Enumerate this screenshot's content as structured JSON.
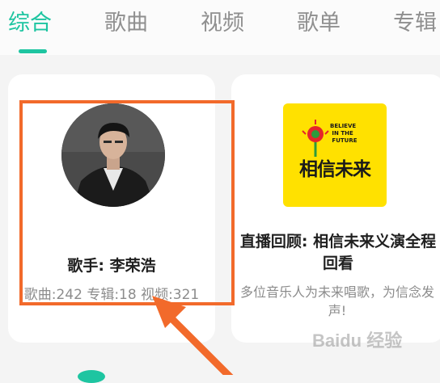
{
  "tabs": [
    {
      "label": "综合",
      "active": true
    },
    {
      "label": "歌曲",
      "active": false
    },
    {
      "label": "视频",
      "active": false
    },
    {
      "label": "歌单",
      "active": false
    },
    {
      "label": "专辑",
      "active": false
    }
  ],
  "artist_card": {
    "name": "歌手: 李荣浩",
    "stats": "歌曲:242 专辑:18 视频:321"
  },
  "event_card": {
    "logo_text": "相信未来",
    "logo_sub": "BELIEVE\n IN THE\n FUTURE",
    "title": "直播回顾: 相信未来义演全程回看",
    "description": "多位音乐人为未来唱歌，为信念发声!"
  },
  "watermark": "Baidu 经验",
  "colors": {
    "accent": "#1ec5a1",
    "highlight": "#f26a2b",
    "logo_bg": "#ffe100"
  }
}
